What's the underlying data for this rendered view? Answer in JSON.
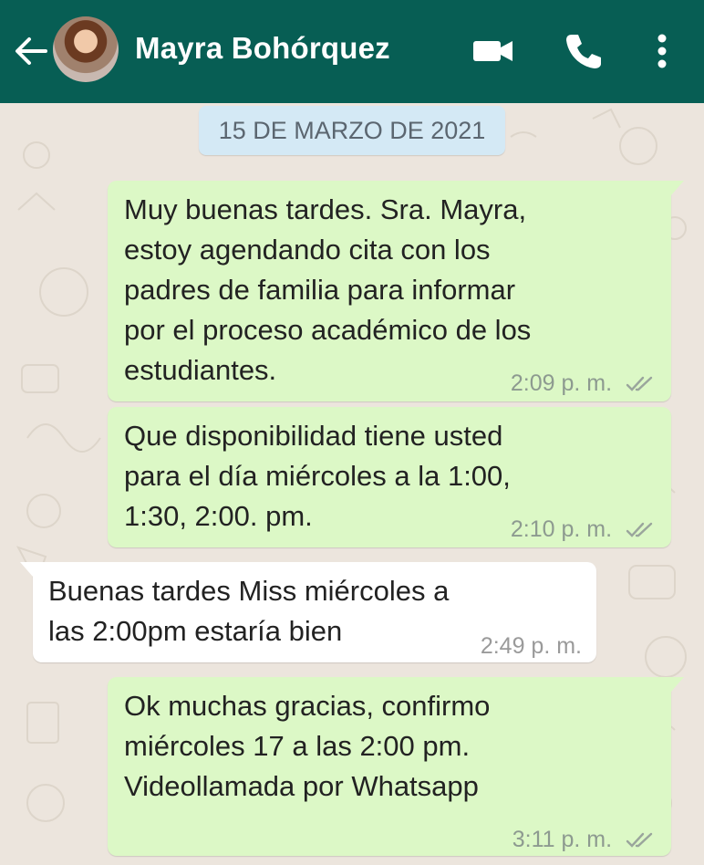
{
  "chat": {
    "contact_name": "Mayra Bohórquez",
    "date_label": "15 DE MARZO DE 2021",
    "messages": [
      {
        "direction": "outgoing",
        "text": "Muy buenas tardes. Sra. Mayra,\nestoy agendando cita con los\npadres de familia para informar\npor el proceso académico de los\nestudiantes.",
        "time": "2:09 p. m.",
        "status": "read-ticks"
      },
      {
        "direction": "outgoing",
        "text": "Que disponibilidad tiene usted\npara el día miércoles a la 1:00,\n1:30, 2:00. pm.",
        "time": "2:10 p. m.",
        "status": "read-ticks"
      },
      {
        "direction": "incoming",
        "text": "Buenas tardes Miss miércoles a\nlas 2:00pm estaría bien",
        "time": "2:49 p. m."
      },
      {
        "direction": "outgoing",
        "text": "Ok muchas gracias, confirmo\nmiércoles 17 a las 2:00 pm.\nVideollamada por Whatsapp",
        "time": "3:11 p. m.",
        "status": "read-ticks"
      }
    ]
  },
  "icons": {
    "back": "arrow-left-icon",
    "video": "video-camera-icon",
    "call": "phone-icon",
    "menu": "more-vert-icon",
    "ticks": "double-check-icon"
  },
  "colors": {
    "header": "#075e54",
    "wallpaper": "#ece5dd",
    "outgoing_bubble": "#dcf8c6",
    "incoming_bubble": "#ffffff",
    "date_pill": "#d4e9f5"
  }
}
